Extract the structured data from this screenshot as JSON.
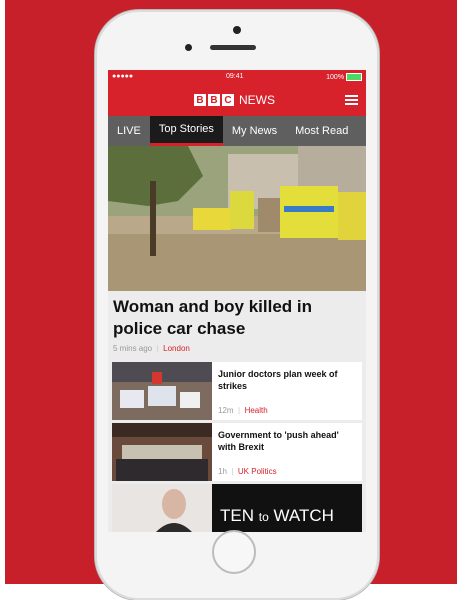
{
  "status_bar": {
    "signal": "●●●●● ",
    "time": "09:41",
    "battery": "100%"
  },
  "app_bar": {
    "logo_letters": [
      "B",
      "B",
      "C"
    ],
    "logo_suffix": "NEWS"
  },
  "tabs": [
    {
      "label": "LIVE"
    },
    {
      "label": "Top Stories"
    },
    {
      "label": "My News"
    },
    {
      "label": "Most Read"
    }
  ],
  "top_story": {
    "headline": "Woman and boy killed in police car chase",
    "time": "5 mins ago",
    "tag": "London"
  },
  "stories": [
    {
      "title": "Junior doctors plan week of strikes",
      "time": "12m",
      "tag": "Health"
    },
    {
      "title": "Government to 'push ahead' with Brexit",
      "time": "1h",
      "tag": "UK Politics"
    }
  ],
  "promo": {
    "text_a": "TEN",
    "text_b": "to",
    "text_c": "WATCH"
  },
  "colors": {
    "brand_red": "#d7222c",
    "background_red": "#c8202a"
  }
}
